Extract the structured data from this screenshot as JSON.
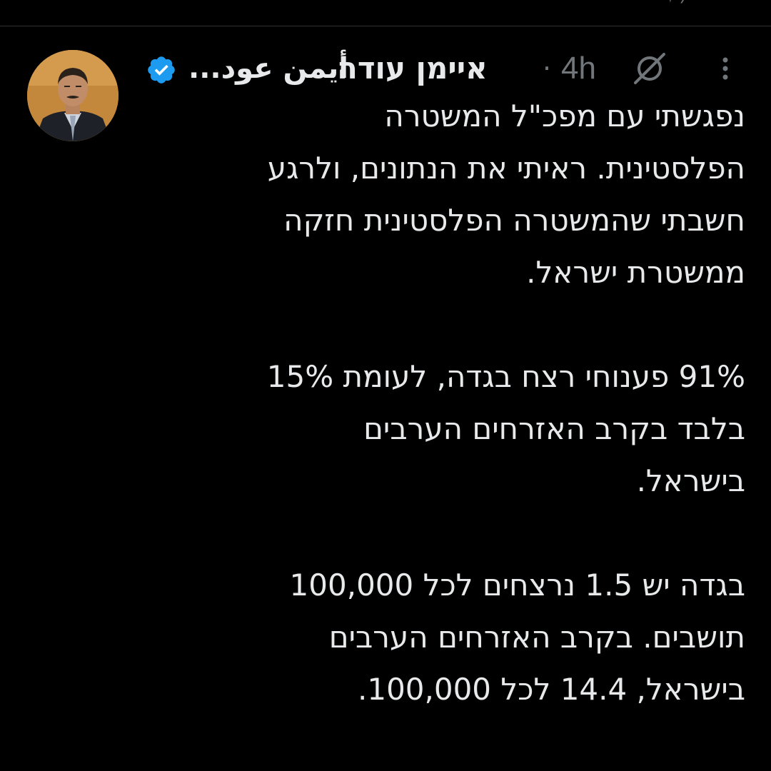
{
  "colors": {
    "background": "#000000",
    "text_primary": "#e7e9ea",
    "text_secondary": "#71767b",
    "verified_blue": "#1d9bf0",
    "divider": "#2f3336"
  },
  "tweet": {
    "author": {
      "hebrew_name": "איימן עודה",
      "arabic_name": "أيمن عود...",
      "verified_icon": "verified-badge-icon",
      "avatar_icon": "profile-photo"
    },
    "separator": "·",
    "timestamp": "4h",
    "grok_icon": "grok-icon",
    "more_icon": "more-vertical-icon",
    "paragraphs": [
      {
        "lines": [
          "נפגשתי עם מפכ\"ל המשטרה",
          "הפלסטינית. ראיתי את הנתונים, ולרגע",
          "חשבתי שהמשטרה הפלסטינית חזקה",
          "ממשטרת ישראל."
        ]
      },
      {
        "lines": [
          "91% פענוחי רצח בגדה, לעומת 15%",
          "בלבד בקרב האזרחים הערבים",
          "בישראל."
        ]
      },
      {
        "lines": [
          "בגדה יש 1.5 נרצחים לכל 100,000",
          "תושבים. בקרב האזרחים הערבים",
          "בישראל, 14.4 לכל 100,000."
        ]
      }
    ]
  }
}
